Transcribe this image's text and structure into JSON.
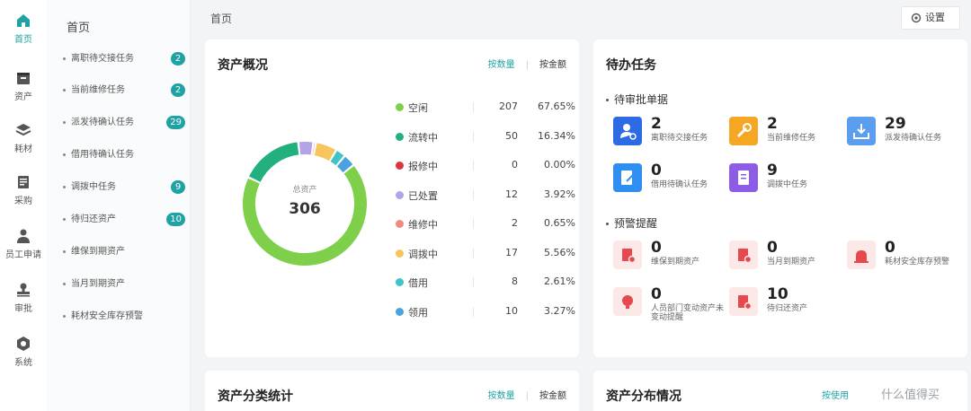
{
  "rail": {
    "items": [
      {
        "label": "首页",
        "icon": "home-icon",
        "active": true
      },
      {
        "label": "资产",
        "icon": "box-icon"
      },
      {
        "label": "耗材",
        "icon": "layers-icon"
      },
      {
        "label": "采购",
        "icon": "document-icon"
      },
      {
        "label": "员工申请",
        "icon": "user-icon"
      },
      {
        "label": "审批",
        "icon": "stamp-icon"
      },
      {
        "label": "系统",
        "icon": "system-icon"
      }
    ]
  },
  "submenu": {
    "title": "首页",
    "items": [
      {
        "label": "离职待交接任务",
        "badge": "2"
      },
      {
        "label": "当前维修任务",
        "badge": "2"
      },
      {
        "label": "派发待确认任务",
        "badge": "29"
      },
      {
        "label": "借用待确认任务",
        "badge": ""
      },
      {
        "label": "调拨中任务",
        "badge": "9"
      },
      {
        "label": "待归还资产",
        "badge": "10"
      },
      {
        "label": "维保到期资产",
        "badge": ""
      },
      {
        "label": "当月到期资产",
        "badge": ""
      },
      {
        "label": "耗材安全库存预警",
        "badge": ""
      }
    ]
  },
  "header": {
    "breadcrumb": "首页",
    "settings_label": "设置"
  },
  "overview": {
    "title": "资产概况",
    "toggle_on": "按数量",
    "toggle_off": "按金额",
    "total_label": "总资产",
    "total_value": "306"
  },
  "chart_data": {
    "type": "pie",
    "style": "donut",
    "categories": [
      "空闲",
      "流转中",
      "报修中",
      "已处置",
      "维修中",
      "调拨中",
      "借用",
      "领用"
    ],
    "values": [
      207,
      50,
      0,
      12,
      2,
      17,
      8,
      10
    ],
    "percents": [
      "67.65%",
      "16.34%",
      "0.00%",
      "3.92%",
      "0.65%",
      "5.56%",
      "2.61%",
      "3.27%"
    ],
    "colors": [
      "#7ed04b",
      "#22b07d",
      "#d9363e",
      "#b3a3e8",
      "#f08a7c",
      "#f7c55c",
      "#3fc3c9",
      "#4aa3df"
    ]
  },
  "todo": {
    "title": "待办任务",
    "pending_section": "待审批单据",
    "pending": [
      {
        "num": "2",
        "label": "离职待交接任务",
        "color": "#2d6be4"
      },
      {
        "num": "2",
        "label": "当前维修任务",
        "color": "#f5a623"
      },
      {
        "num": "29",
        "label": "派发待确认任务",
        "color": "#5b9ef0"
      },
      {
        "num": "0",
        "label": "借用待确认任务",
        "color": "#2f8ff0"
      },
      {
        "num": "9",
        "label": "调拨中任务",
        "color": "#8c5ce6"
      }
    ],
    "warning_section": "预警提醒",
    "warnings": [
      {
        "num": "0",
        "label": "维保到期资产"
      },
      {
        "num": "0",
        "label": "当月到期资产"
      },
      {
        "num": "0",
        "label": "耗材安全库存预警"
      },
      {
        "num": "0",
        "label": "人员部门变动资产未变动提醒"
      },
      {
        "num": "10",
        "label": "待归还资产"
      }
    ]
  },
  "category_stats": {
    "title": "资产分类统计",
    "toggle_on": "按数量",
    "toggle_off": "按金额"
  },
  "distribution": {
    "title": "资产分布情况",
    "toggle_on": "按使用"
  },
  "watermark": "什么值得买"
}
